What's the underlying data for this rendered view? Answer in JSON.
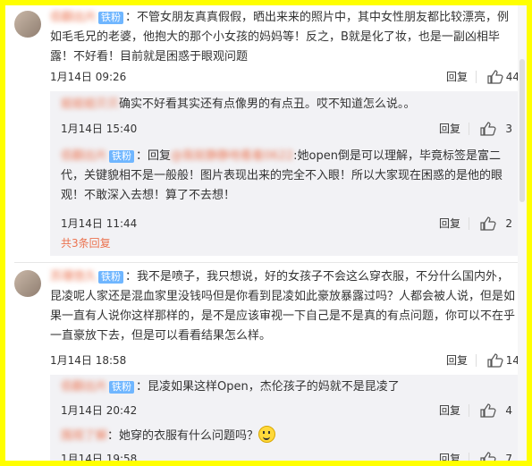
{
  "comments": [
    {
      "name": "佰翻出片",
      "badge": "铁粉",
      "text": "：不管女朋友真真假假，晒出来来的照片中，其中女性朋友都比较漂亮，例如毛毛兄的老婆，他抱大的那个小女孩的妈妈等！反之，B就是化了妆，也是一副凶相毕露！不好看！目前就是困惑于眼观问题",
      "date": "1月14日 09:26",
      "reply": "回复",
      "likes": "44"
    },
    {
      "name": "苏珊悠久",
      "badge": "铁粉",
      "text": "：我不是喷子，我只想说，好的女孩子不会这么穿衣服，不分什么国内外，昆凌呢人家还是混血家里没钱吗但是你看到昆凌如此豪放暴露过吗？人都会被人说，但是如果一直有人说你这样那样的，是不是应该审视一下自己是不是真的有点问题，你可以不在乎一直豪放下去，但是可以看看结果怎么样。",
      "date": "1月14日 18:58",
      "reply": "回复",
      "likes": "14"
    }
  ],
  "replies_1": [
    {
      "name": "姐姐姐贝贝",
      "text": "确实不好看其实还有点像男的有点丑。哎不知道怎么说。。",
      "date": "1月14日 15:40",
      "reply": "回复",
      "likes": "3"
    },
    {
      "name": "佰翻出片",
      "badge": "铁粉",
      "text_prefix": "：回复",
      "reply_to": "@我就静静地看着0622",
      "text": ":她open倒是可以理解，毕竟标签是富二代，关键貌相不是一般般！图片表现出来的完全不入眼！所以大家现在困惑的是他的眼观！不敢深入去想！算了不去想！",
      "date": "1月14日 11:44",
      "reply": "回复",
      "likes": "2"
    }
  ],
  "more_replies": "共3条回复",
  "replies_2": [
    {
      "name": "佰翻出片",
      "badge": "铁粉",
      "text": "：昆凌如果这样Open，杰伦孩子的妈就不是昆凌了",
      "date": "1月14日 20:42",
      "reply": "回复",
      "likes": "4"
    },
    {
      "name": "围观了解",
      "text": "：她穿的衣服有什么问题吗？",
      "date": "1月14日 19:58",
      "reply": "回复",
      "likes": "7"
    }
  ]
}
